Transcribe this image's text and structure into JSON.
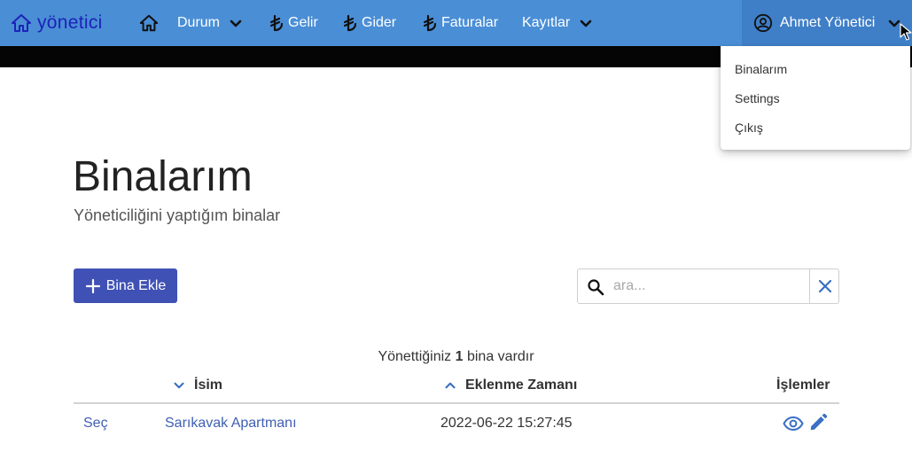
{
  "brand": {
    "name": "yönetici",
    "icon": "home-outline-icon"
  },
  "nav": {
    "items": [
      {
        "label": "",
        "icon": "home-icon"
      },
      {
        "label": "Durum",
        "icon": "chevron-down-icon"
      },
      {
        "label": "Gelir",
        "icon": "lira-icon"
      },
      {
        "label": "Gider",
        "icon": "lira-icon"
      },
      {
        "label": "Faturalar",
        "icon": "lira-icon"
      },
      {
        "label": "Kayıtlar",
        "icon": "chevron-down-icon"
      }
    ],
    "user": {
      "name": "Ahmet Yönetici",
      "icon": "account-circle-icon"
    }
  },
  "user_dropdown": {
    "items": [
      "Binalarım",
      "Settings",
      "Çıkış"
    ]
  },
  "page": {
    "title": "Binalarım",
    "subtitle": "Yöneticiliğini yaptığım binalar"
  },
  "actions": {
    "add_label": "Bina Ekle",
    "search_placeholder": "ara..."
  },
  "summary": {
    "prefix": "Yönettiğiniz",
    "count": "1",
    "suffix": "bina vardır"
  },
  "table": {
    "columns": [
      "İsim",
      "Eklenme Zamanı",
      "İşlemler"
    ],
    "rows": [
      {
        "select": "Seç",
        "name": "Sarıkavak Apartmanı",
        "added": "2022-06-22 15:27:45"
      }
    ]
  },
  "colors": {
    "navbar": "#4a8ed6",
    "user_menu": "#3f7fc7",
    "primary_button": "#4051b5",
    "link": "#3f5fb3",
    "brand": "#1d22b8"
  }
}
